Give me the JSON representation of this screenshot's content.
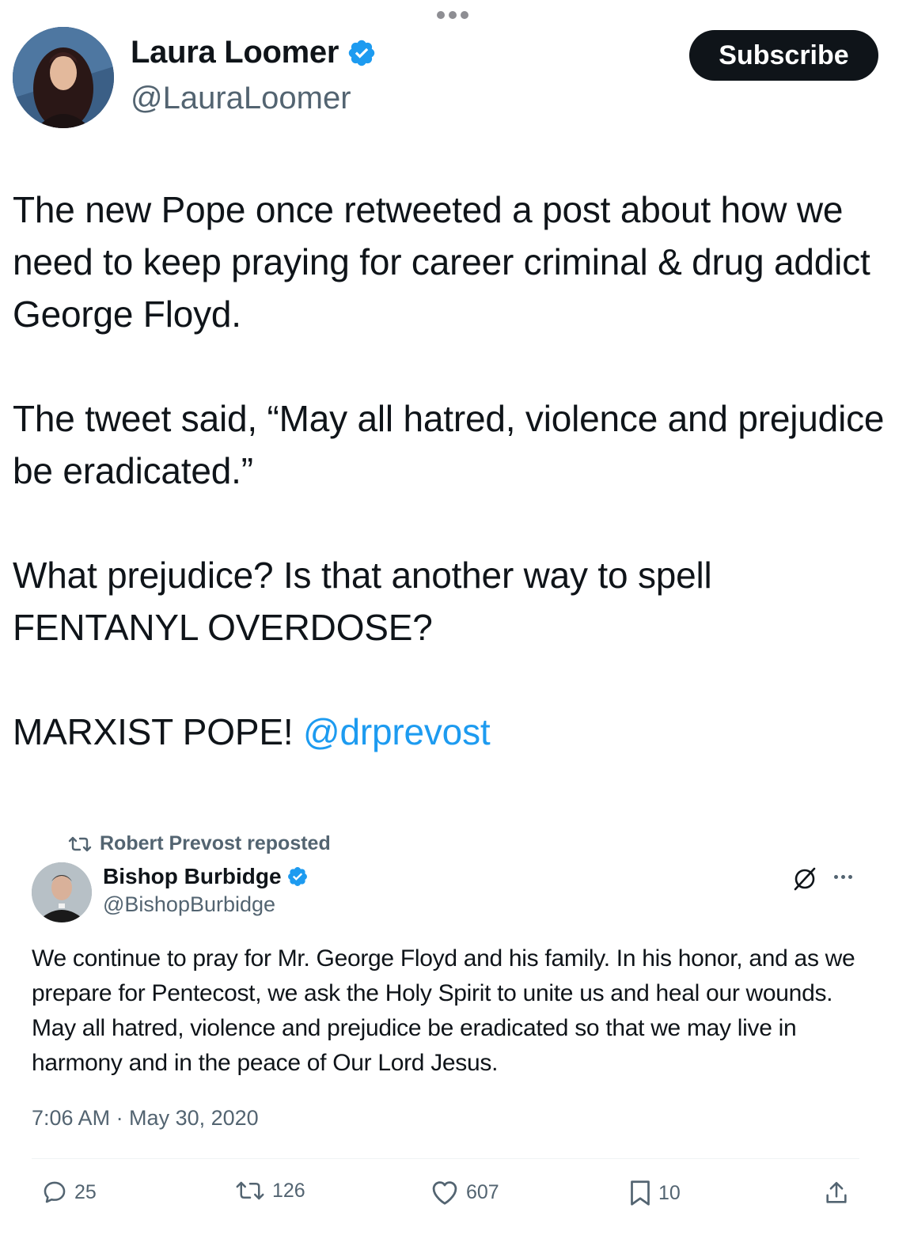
{
  "header": {
    "display_name": "Laura Loomer",
    "handle": "@LauraLoomer",
    "subscribe_label": "Subscribe"
  },
  "post": {
    "para1": "The new Pope once retweeted a post about how we need to keep praying for career criminal & drug addict George Floyd.",
    "para2": "The tweet said, “May all hatred, violence and prejudice be eradicated.”",
    "para3": "What prejudice? Is that another way to spell FENTANYL OVERDOSE?",
    "para4_text": "MARXIST POPE! ",
    "para4_mention": "@drprevost"
  },
  "embed": {
    "repost_label": "Robert Prevost reposted",
    "display_name": "Bishop Burbidge",
    "handle": "@BishopBurbidge",
    "text": "We continue to pray for Mr. George Floyd and his family. In his honor, and as we prepare for Pentecost, we ask the Holy Spirit to unite us and heal our wounds. May all hatred, violence and prejudice be eradicated so that we may live in harmony and in the peace of Our Lord Jesus.",
    "timestamp": "7:06 AM · May 30, 2020",
    "replies": "25",
    "reposts": "126",
    "likes": "607",
    "bookmarks": "10"
  },
  "colors": {
    "accent": "#1d9bf0",
    "text": "#0f1419",
    "secondary": "#536471",
    "button_bg": "#0f1419"
  },
  "icons": [
    "more-dots-icon",
    "verified-badge-icon",
    "repost-icon",
    "grok-icon",
    "more-icon",
    "reply-icon",
    "retweet-icon",
    "like-icon",
    "bookmark-icon",
    "share-icon"
  ]
}
